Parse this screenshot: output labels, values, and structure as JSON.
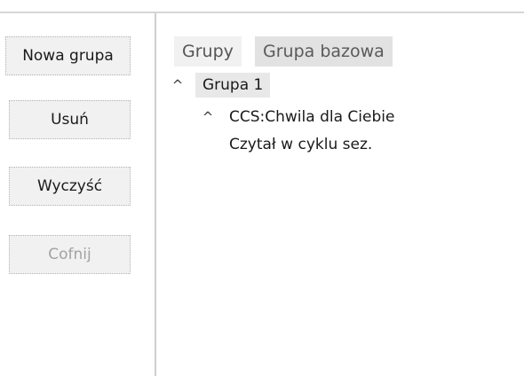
{
  "buttons": {
    "new_group": "Nowa grupa",
    "delete": "Usuń",
    "clear": "Wyczyść",
    "undo": "Cofnij"
  },
  "tabs": [
    {
      "label": "Grupy"
    },
    {
      "label": "Grupa bazowa"
    }
  ],
  "tree": {
    "group": {
      "label": "Grupa 1",
      "expanded": true
    },
    "subgroup": {
      "label": "CCS:Chwila dla Ciebie",
      "expanded": true
    },
    "leaf": {
      "label": "Czytał w cyklu sez."
    }
  },
  "icons": {
    "expand": "chevron-up-icon"
  },
  "colors": {
    "button_bg": "#f1f1f1",
    "tab_bg": "#e2e2e2",
    "disabled_text": "#a3a3a3"
  }
}
